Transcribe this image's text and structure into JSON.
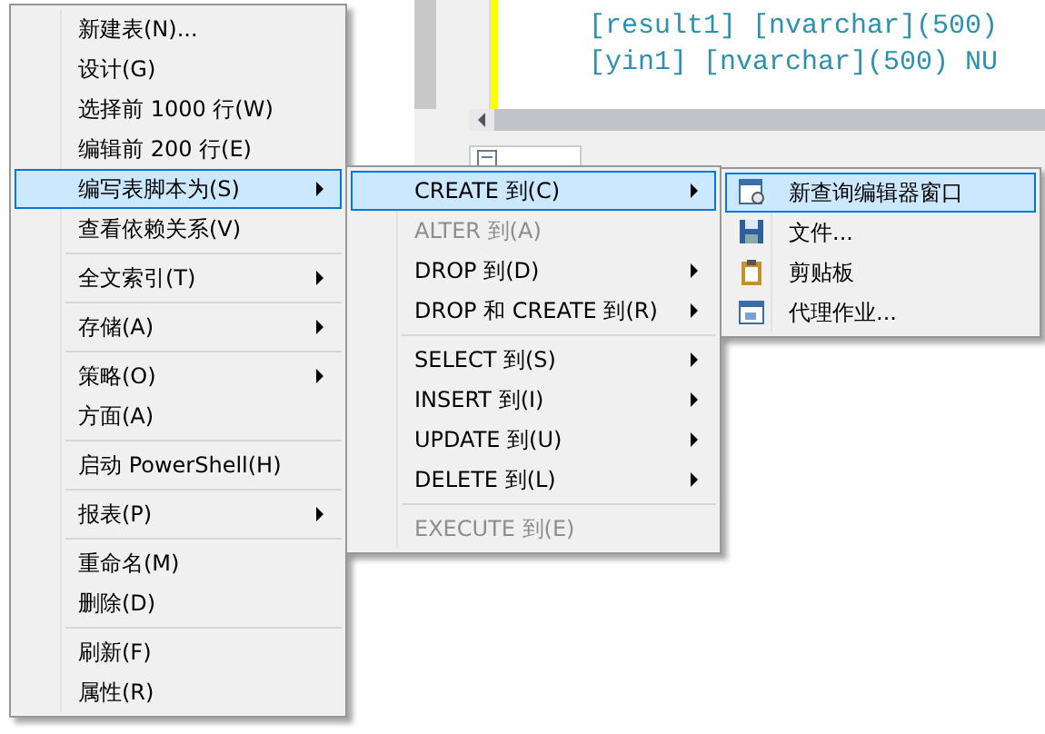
{
  "editor": {
    "lines": [
      "[result1] [nvarchar](500)",
      "[yin1] [nvarchar](500) NU"
    ]
  },
  "menus": [
    {
      "items": [
        {
          "kind": "item",
          "label": "新建表(N)...",
          "submenu": false,
          "selected": false,
          "disabled": false
        },
        {
          "kind": "item",
          "label": "设计(G)",
          "submenu": false,
          "selected": false,
          "disabled": false
        },
        {
          "kind": "item",
          "label": "选择前 1000 行(W)",
          "submenu": false,
          "selected": false,
          "disabled": false
        },
        {
          "kind": "item",
          "label": "编辑前 200 行(E)",
          "submenu": false,
          "selected": false,
          "disabled": false
        },
        {
          "kind": "item",
          "label": "编写表脚本为(S)",
          "submenu": true,
          "selected": true,
          "disabled": false
        },
        {
          "kind": "item",
          "label": "查看依赖关系(V)",
          "submenu": false,
          "selected": false,
          "disabled": false
        },
        {
          "kind": "separator"
        },
        {
          "kind": "item",
          "label": "全文索引(T)",
          "submenu": true,
          "selected": false,
          "disabled": false
        },
        {
          "kind": "separator"
        },
        {
          "kind": "item",
          "label": "存储(A)",
          "submenu": true,
          "selected": false,
          "disabled": false
        },
        {
          "kind": "separator"
        },
        {
          "kind": "item",
          "label": "策略(O)",
          "submenu": true,
          "selected": false,
          "disabled": false
        },
        {
          "kind": "item",
          "label": "方面(A)",
          "submenu": false,
          "selected": false,
          "disabled": false
        },
        {
          "kind": "separator"
        },
        {
          "kind": "item",
          "label": "启动 PowerShell(H)",
          "submenu": false,
          "selected": false,
          "disabled": false
        },
        {
          "kind": "separator"
        },
        {
          "kind": "item",
          "label": "报表(P)",
          "submenu": true,
          "selected": false,
          "disabled": false
        },
        {
          "kind": "separator"
        },
        {
          "kind": "item",
          "label": "重命名(M)",
          "submenu": false,
          "selected": false,
          "disabled": false
        },
        {
          "kind": "item",
          "label": "删除(D)",
          "submenu": false,
          "selected": false,
          "disabled": false
        },
        {
          "kind": "separator"
        },
        {
          "kind": "item",
          "label": "刷新(F)",
          "submenu": false,
          "selected": false,
          "disabled": false
        },
        {
          "kind": "item",
          "label": "属性(R)",
          "submenu": false,
          "selected": false,
          "disabled": false
        }
      ]
    },
    {
      "items": [
        {
          "kind": "item",
          "label": "CREATE 到(C)",
          "submenu": true,
          "selected": true,
          "disabled": false
        },
        {
          "kind": "item",
          "label": "ALTER 到(A)",
          "submenu": false,
          "selected": false,
          "disabled": true
        },
        {
          "kind": "item",
          "label": "DROP 到(D)",
          "submenu": true,
          "selected": false,
          "disabled": false
        },
        {
          "kind": "item",
          "label": "DROP 和 CREATE 到(R)",
          "submenu": true,
          "selected": false,
          "disabled": false
        },
        {
          "kind": "separator"
        },
        {
          "kind": "item",
          "label": "SELECT 到(S)",
          "submenu": true,
          "selected": false,
          "disabled": false
        },
        {
          "kind": "item",
          "label": "INSERT 到(I)",
          "submenu": true,
          "selected": false,
          "disabled": false
        },
        {
          "kind": "item",
          "label": "UPDATE 到(U)",
          "submenu": true,
          "selected": false,
          "disabled": false
        },
        {
          "kind": "item",
          "label": "DELETE 到(L)",
          "submenu": true,
          "selected": false,
          "disabled": false
        },
        {
          "kind": "separator"
        },
        {
          "kind": "item",
          "label": "EXECUTE 到(E)",
          "submenu": false,
          "selected": false,
          "disabled": true
        }
      ]
    },
    {
      "items": [
        {
          "kind": "item",
          "label": "新查询编辑器窗口",
          "submenu": false,
          "selected": true,
          "disabled": false
        },
        {
          "kind": "item",
          "label": "文件...",
          "submenu": false,
          "selected": false,
          "disabled": false
        },
        {
          "kind": "item",
          "label": "剪贴板",
          "submenu": false,
          "selected": false,
          "disabled": false
        },
        {
          "kind": "item",
          "label": "代理作业...",
          "submenu": false,
          "selected": false,
          "disabled": false
        }
      ]
    }
  ]
}
